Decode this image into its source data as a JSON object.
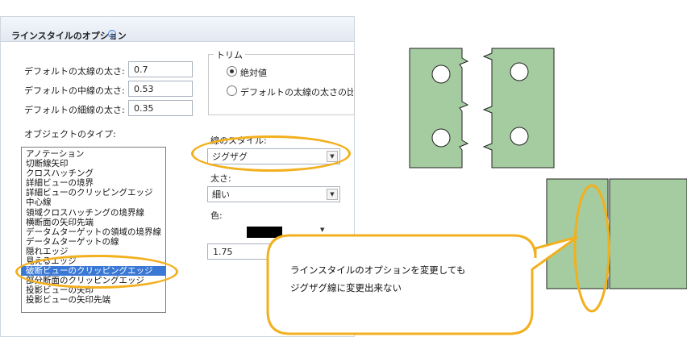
{
  "panel": {
    "title": "ラインスタイルのオプション",
    "info_icon": "i",
    "thick_label": "デフォルトの太線の太さ:",
    "thick_value": "0.7",
    "medium_label": "デフォルトの中線の太さ:",
    "medium_value": "0.53",
    "thin_label": "デフォルトの細線の太さ:",
    "thin_value": "0.35",
    "trim": {
      "title": "トリム",
      "option_absolute": "絶対値",
      "option_ratio": "デフォルトの太線の太さの比率"
    },
    "object_type_label": "オブジェクトのタイプ:",
    "object_types": [
      "アノテーション",
      "切断線矢印",
      "クロスハッチング",
      "詳細ビューの境界",
      "詳細ビューのクリッピングエッジ",
      "中心線",
      "領域クロスハッチングの境界線",
      "横断面の矢印先端",
      "データムターゲットの領域の境界線",
      "データムターゲットの線",
      "隠れエッジ",
      "見えるエッジ",
      "破断ビューのクリッピングエッジ",
      "部分断面のクリッピングエッジ",
      "投影ビューの矢印",
      "投影ビューの矢印先端"
    ],
    "selected_index": 12,
    "line_style_label": "線のスタイル:",
    "line_style_value": "ジグザグ",
    "thickness_label": "太さ:",
    "thickness_value": "細い",
    "color_label": "色:",
    "color_value": "#000000",
    "extra_value": "1.75",
    "dropdown_arrow": "▼"
  },
  "callout": {
    "line1": "ラインスタイルのオプションを変更しても",
    "line2": "ジグザグ線に変更出来ない"
  },
  "colors": {
    "highlight": "#f2b01e",
    "part_fill": "#a5cca0",
    "selection": "#3a78d6"
  }
}
